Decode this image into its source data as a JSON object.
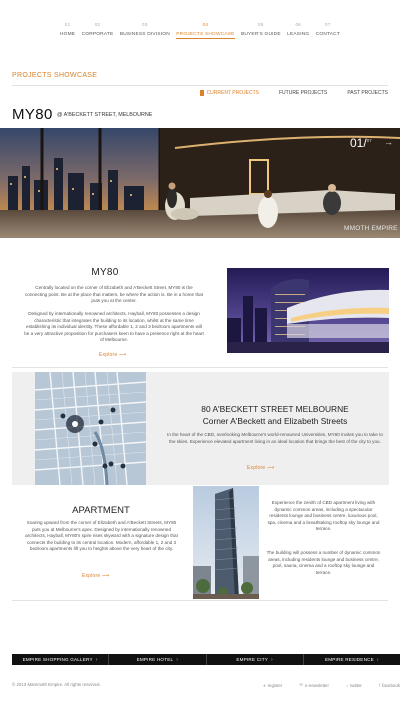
{
  "nav": [
    {
      "num": "01",
      "label": "HOME"
    },
    {
      "num": "02",
      "label": "CORPORATE"
    },
    {
      "num": "03",
      "label": "BUSINESS DIVISION"
    },
    {
      "num": "04",
      "label": "PROJECTS SHOWCASE"
    },
    {
      "num": "05",
      "label": "BUYER'S GUIDE"
    },
    {
      "num": "06",
      "label": "LEASING"
    },
    {
      "num": "07",
      "label": "CONTACT"
    }
  ],
  "active_nav": 3,
  "section_title": "PROJECTS SHOWCASE",
  "subnav": [
    "CURRENT PROJECTS",
    "FUTURE PROJECTS",
    "PAST PROJECTS"
  ],
  "project": {
    "name": "MY80",
    "address": "@ A'BECKETT STREET, MELBOURNE"
  },
  "hero": {
    "current": "01/",
    "total": "07",
    "arrow": "→",
    "brand": "MMOTH EMPIRE"
  },
  "row1": {
    "title": "MY80",
    "p1": "Centrally located on the corner of Elizabeth and A'Beckett Street, MY80 is the connecting point. Be at the place that matters, be where the action is. Be in a home that puts you at the center.",
    "p2": "Designed by internationally renowned architects, Hayball, MY80 possesses a design characteristic that integrates the building to its location, whilst at the same time establishing its individual identity. These affordable 1, 2 and 3 bedroom apartments will be a very attractive proposition for purchasers keen to have a presence right at the heart of Melbourne.",
    "explore": "Explore"
  },
  "row2": {
    "title_line1": "80 A'BECKETT STREET MELBOURNE",
    "title_line2": "Corner A'Beckett and Elizabeth Streets",
    "text": "In the heart of the CBD, overlooking Melbourne's world-renowned Universities, MY80 invites you to take to the skies. Experience elevated apartment living in an ideal location that brings the best of the city to you.",
    "explore": "Explore"
  },
  "row3": {
    "title": "APARTMENT",
    "text": "Soaring upward from the corner of Elizabeth and A'Beckett Streets, MY80 puts you at Melbourne's apex. Designed by internationally renowned architects, Hayball, MY80's spire rises skyward with a signature design that connects the building to its central location. Modern, affordable 1, 2 and 3 bedroom apartments lift you to heights above the very heart of the city.",
    "explore": "Explore",
    "right_p1": "Experience the zenith of CBD apartment living with dynamic common areas, including a spectacular residents lounge and business centre, luxurious pool, spa, cinema and a breathtaking rooftop sky lounge and terrace.",
    "right_p2": "The building will possess a number of dynamic common areas, including residents lounge and business centre, pool, sauna, cinema and a rooftop sky lounge and terrace."
  },
  "footer_bar": [
    "EMPIRE SHOPPING GALLERY",
    "EMPIRE HOTEL",
    "EMPIRE CITY",
    "EMPIRE RESIDENCE"
  ],
  "copyright": "© 2013 Mammoth Empire. All rights reserved.",
  "social": [
    {
      "icon": "user-icon",
      "glyph": "♦",
      "label": "register"
    },
    {
      "icon": "mail-icon",
      "glyph": "✉",
      "label": "e-newsletter"
    },
    {
      "icon": "twitter-icon",
      "glyph": "♪",
      "label": "twitter"
    },
    {
      "icon": "facebook-icon",
      "glyph": "f",
      "label": "facebook"
    }
  ],
  "colors": {
    "accent": "#d9822b",
    "text": "#333333",
    "footer": "#111111"
  }
}
